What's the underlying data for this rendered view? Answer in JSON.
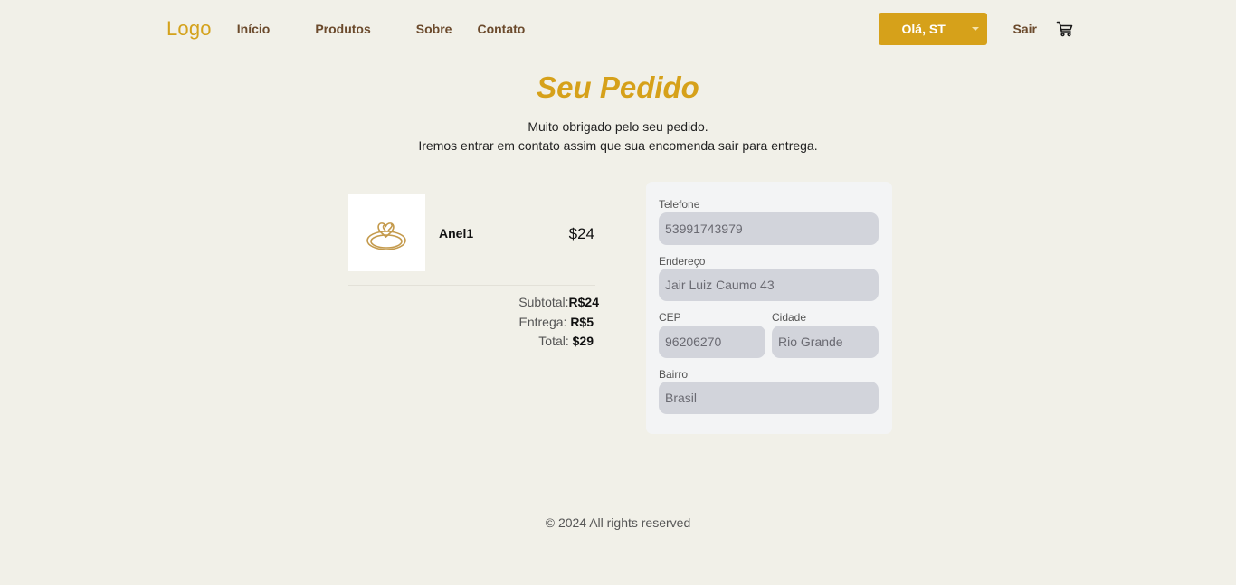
{
  "header": {
    "logo": "Logo",
    "nav": [
      "Início",
      "Produtos",
      "Sobre",
      "Contato"
    ],
    "user_label": "Olá, ST",
    "logout_label": "Sair",
    "cart_icon": "cart-icon",
    "accent_color": "#d6a11a"
  },
  "main": {
    "title": "Seu Pedido",
    "message_line1": "Muito obrigado pelo seu pedido.",
    "message_line2": "Iremos entrar em contato assim que sua encomenda sair para entrega."
  },
  "order": {
    "item_name": "Anel1",
    "item_price": "$24",
    "item_image_icon": "ring-icon",
    "subtotal_label": "Subtotal:",
    "subtotal_value": "R$24",
    "delivery_label": "Entrega:",
    "delivery_value": "R$5",
    "total_label": "Total:",
    "total_value": "$29"
  },
  "form": {
    "phone_label": "Telefone",
    "phone_value": "53991743979",
    "address_label": "Endereço",
    "address_value": "Jair Luiz Caumo 43",
    "cep_label": "CEP",
    "cep_value": "96206270",
    "city_label": "Cidade",
    "city_value": "Rio Grande",
    "district_label": "Bairro",
    "district_value": "Brasil"
  },
  "footer": {
    "copyright": "© 2024 All rights reserved"
  }
}
